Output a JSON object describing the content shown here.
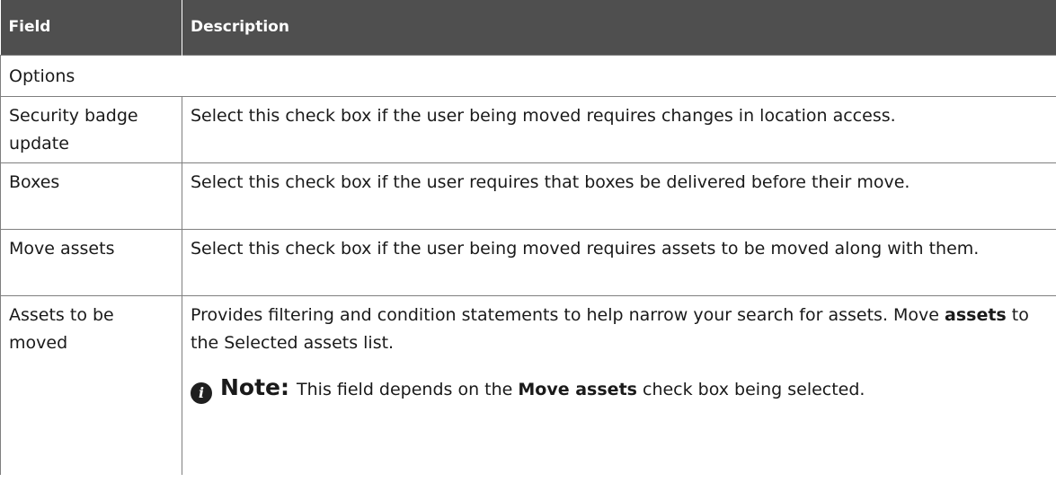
{
  "header": {
    "field": "Field",
    "description": "Description"
  },
  "section": "Options",
  "rows": [
    {
      "field": "Security badge update",
      "description": "Select this check box if the user being moved requires changes in location access."
    },
    {
      "field": "Boxes",
      "description": "Select this check box if the user requires that boxes be delivered before their move."
    },
    {
      "field": "Move assets",
      "description": "Select this check box if the user being moved requires assets to be moved along with them."
    },
    {
      "field": "Assets to be moved",
      "description_pre": "Provides filtering and condition statements to help narrow your search for assets. Move ",
      "description_bold": "assets",
      "description_post": " to the Selected assets list.",
      "note": {
        "icon": "info-icon",
        "label": "Note:",
        "text_pre": "This field depends on the ",
        "text_bold": "Move assets",
        "text_post": " check box being selected."
      }
    }
  ]
}
